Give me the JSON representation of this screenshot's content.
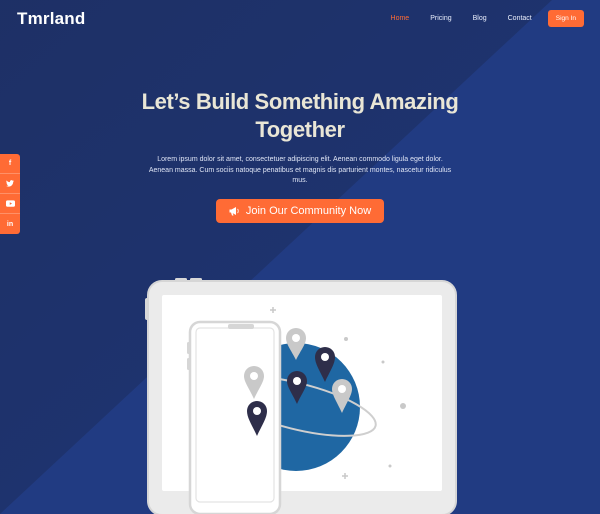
{
  "brand": "Tmrland",
  "nav": {
    "links": [
      {
        "label": "Home",
        "active": true
      },
      {
        "label": "Pricing",
        "active": false
      },
      {
        "label": "Blog",
        "active": false
      },
      {
        "label": "Contact",
        "active": false
      }
    ],
    "signin_label": "Sign In"
  },
  "hero": {
    "title_line1": "Let’s Build Something Amazing",
    "title_line2": "Together",
    "description": "Lorem ipsum dolor sit amet, consectetuer adipiscing elit. Aenean commodo ligula eget dolor. Aenean massa. Cum sociis natoque penatibus et magnis dis parturient montes, nascetur ridiculus mus.",
    "cta_label": "Join Our Community Now"
  },
  "social": [
    {
      "icon": "facebook-icon",
      "glyph": "f"
    },
    {
      "icon": "twitter-icon",
      "glyph": "t"
    },
    {
      "icon": "youtube-icon",
      "glyph": "▶"
    },
    {
      "icon": "linkedin-icon",
      "glyph": "in"
    }
  ],
  "colors": {
    "accent": "#ff6b35",
    "background": "#213b82",
    "title": "#e9e6d6",
    "globe": "#1f67a3"
  }
}
